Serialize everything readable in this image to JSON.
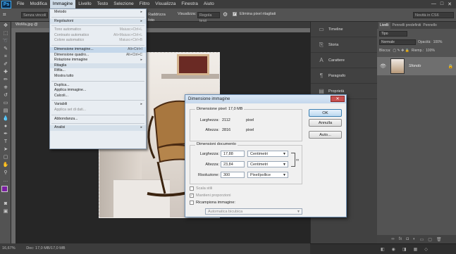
{
  "app": {
    "logo": "Ps"
  },
  "menubar": {
    "items": [
      "File",
      "Modifica",
      "Immagine",
      "Livello",
      "Testo",
      "Selezione",
      "Filtro",
      "Visualizza",
      "Finestra",
      "Aiuto"
    ],
    "window_buttons": [
      "—",
      "□",
      "✕"
    ]
  },
  "options": {
    "field1": "Senza vincoli",
    "field2": "Raddrizza foto",
    "visualizza_label": "Visualizza:",
    "visualizza_value": "Regola terzi",
    "elimina_label": "Elimina pixel ritagliati",
    "workspace": "Novità in CS6"
  },
  "document": {
    "tab_title": "WoMa.jpg @ 16,7%",
    "status": "Doc: 17,0 MB/17,0 MB",
    "zoom": "16,67%"
  },
  "dock": {
    "items": [
      {
        "icon": "timeline-icon",
        "label": "Timeline"
      },
      {
        "icon": "history-icon",
        "label": "Storia"
      },
      {
        "icon": "character-icon",
        "label": "Carattere"
      },
      {
        "icon": "paragraph-icon",
        "label": "Paragrafo"
      },
      {
        "icon": "properties-icon",
        "label": "Proprietà"
      }
    ]
  },
  "layers": {
    "tabs": [
      "Livelli",
      "Pennelli predefiniti",
      "Pennello"
    ],
    "kind": "Tipo",
    "blend": "Normale",
    "opacity_label": "Opacità:",
    "opacity": "100%",
    "lock_label": "Blocca:",
    "fill_label": "Riemp.:",
    "fill": "100%",
    "layer_name": "Sfondo"
  },
  "menu": {
    "items": [
      {
        "label": "Metodo",
        "shortcut": "▸",
        "state": "normal"
      },
      {
        "sep": true
      },
      {
        "label": "Regolazioni",
        "shortcut": "▸",
        "state": "group"
      },
      {
        "sep": true
      },
      {
        "label": "Tono automatico",
        "shortcut": "Maiusc+Ctrl+L",
        "state": "disabled"
      },
      {
        "label": "Contrasto automatico",
        "shortcut": "Alt+Maiusc+Ctrl+L",
        "state": "disabled"
      },
      {
        "label": "Colore automatico",
        "shortcut": "Maiusc+Ctrl+B",
        "state": "disabled"
      },
      {
        "sep": true
      },
      {
        "label": "Dimensione immagine...",
        "shortcut": "Alt+Ctrl+I",
        "state": "hl"
      },
      {
        "label": "Dimensione quadro...",
        "shortcut": "Alt+Ctrl+C",
        "state": "normal"
      },
      {
        "label": "Rotazione immagine",
        "shortcut": "▸",
        "state": "normal"
      },
      {
        "label": "Ritaglia",
        "shortcut": "",
        "state": "group"
      },
      {
        "label": "Rifila...",
        "shortcut": "",
        "state": "normal"
      },
      {
        "label": "Mostra tutto",
        "shortcut": "",
        "state": "normal"
      },
      {
        "sep": true
      },
      {
        "label": "Duplica...",
        "shortcut": "",
        "state": "normal"
      },
      {
        "label": "Applica immagine...",
        "shortcut": "",
        "state": "normal"
      },
      {
        "label": "Calcoli...",
        "shortcut": "",
        "state": "normal"
      },
      {
        "sep": true
      },
      {
        "label": "Variabili",
        "shortcut": "▸",
        "state": "normal"
      },
      {
        "label": "Applica set di dati...",
        "shortcut": "",
        "state": "disabled"
      },
      {
        "sep": true
      },
      {
        "label": "Abbondanza...",
        "shortcut": "",
        "state": "normal"
      },
      {
        "sep": true
      },
      {
        "label": "Analisi",
        "shortcut": "▸",
        "state": "group"
      }
    ]
  },
  "dialog": {
    "title": "Dimensione immagine",
    "pixel_dims_label": "Dimensione pixel:",
    "pixel_dims_value": "17,0 MB",
    "larghezza_label": "Larghezza:",
    "larghezza_px": "2112",
    "altezza_label": "Altezza:",
    "altezza_px": "2816",
    "unit_px": "pixel",
    "doc_dims_label": "Dimensioni documento",
    "doc_larghezza": "17,88",
    "doc_altezza": "23,84",
    "risoluzione_label": "Risoluzione:",
    "risoluzione": "300",
    "unit_cm": "Centimetri",
    "unit_res": "Pixel/pollice",
    "ok": "OK",
    "annulla": "Annulla",
    "auto": "Auto...",
    "scala_stili": "Scala stili",
    "mantieni": "Mantieni proporzioni",
    "ricampiona": "Ricampiona immagine:",
    "ricampiona_method": "Automatica bicubica"
  }
}
